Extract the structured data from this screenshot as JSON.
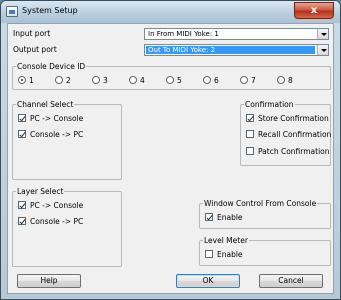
{
  "window": {
    "title": "System Setup",
    "close_symbol": "x"
  },
  "ports": {
    "input_label": "Input port",
    "input_value": "In From MIDI Yoke:  1",
    "output_label": "Output port",
    "output_value": "Out To MIDI Yoke:  2"
  },
  "console_device_id": {
    "title": "Console Device ID",
    "options": [
      "1",
      "2",
      "3",
      "4",
      "5",
      "6",
      "7",
      "8"
    ],
    "selected": "1"
  },
  "channel_select": {
    "title": "Channel Select",
    "items": [
      {
        "label": "PC -> Console",
        "checked": true
      },
      {
        "label": "Console -> PC",
        "checked": true
      }
    ]
  },
  "confirmation": {
    "title": "Confirmation",
    "items": [
      {
        "label": "Store Confirmation",
        "checked": true
      },
      {
        "label": "Recall Confirmation",
        "checked": false
      },
      {
        "label": "Patch Confirmation",
        "checked": false
      }
    ]
  },
  "layer_select": {
    "title": "Layer Select",
    "items": [
      {
        "label": "PC -> Console",
        "checked": true
      },
      {
        "label": "Console -> PC",
        "checked": true
      }
    ]
  },
  "window_control": {
    "title": "Window Control From Console",
    "enable_label": "Enable",
    "checked": true
  },
  "level_meter": {
    "title": "Level Meter",
    "enable_label": "Enable",
    "checked": false
  },
  "buttons": {
    "help": "Help",
    "ok": "OK",
    "cancel": "Cancel"
  }
}
